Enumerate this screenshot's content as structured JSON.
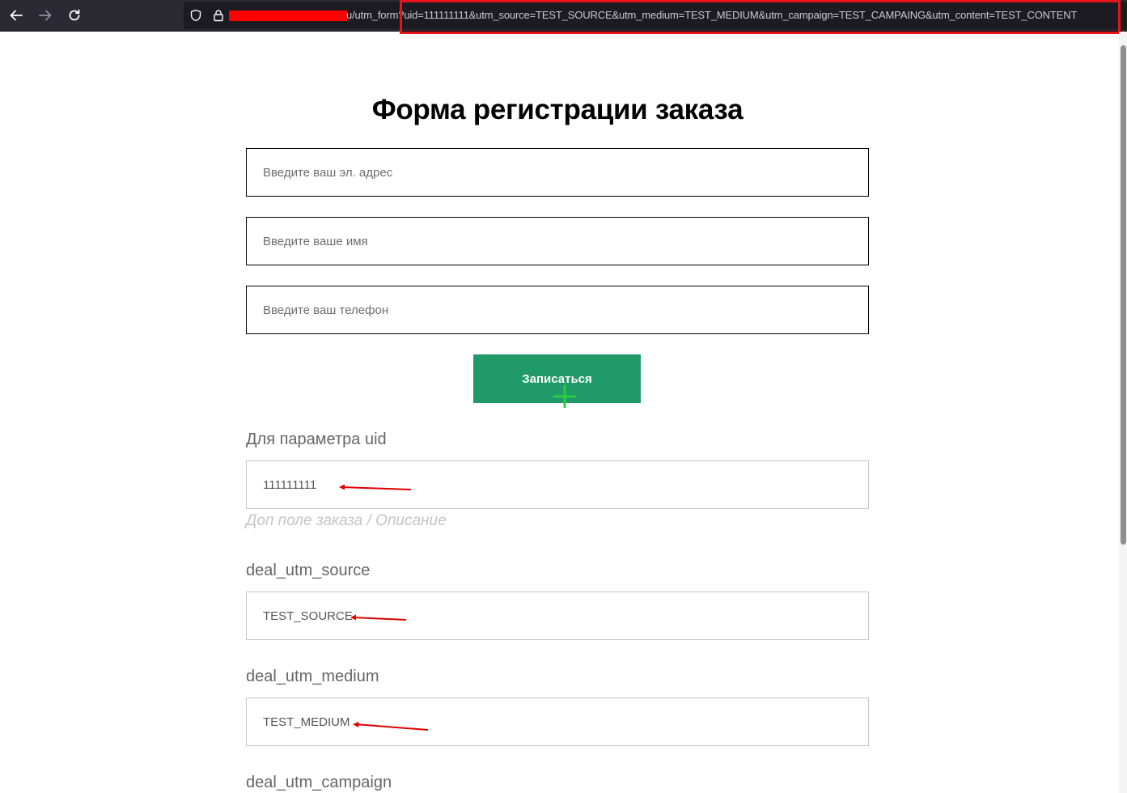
{
  "browser": {
    "url_visible": "u/utm_form?uid=111111111&utm_source=TEST_SOURCE&utm_medium=TEST_MEDIUM&utm_campaign=TEST_CAMPAING&utm_content=TEST_CONTENT",
    "highlight_color": "#e8141c",
    "redaction_color": "#ff0000"
  },
  "page": {
    "title": "Форма регистрации заказа",
    "fields": {
      "email_placeholder": "Введите ваш эл. адрес",
      "name_placeholder": "Введите ваше имя",
      "phone_placeholder": "Введите ваш телефон"
    },
    "submit_label": "Записаться",
    "uid": {
      "label": "Для параметра uid",
      "value": "111111111",
      "hint": "Доп поле заказа / Описание"
    },
    "utm_source": {
      "label": "deal_utm_source",
      "value": "TEST_SOURCE"
    },
    "utm_medium": {
      "label": "deal_utm_medium",
      "value": "TEST_MEDIUM"
    },
    "utm_campaign": {
      "label": "deal_utm_campaign"
    },
    "colors": {
      "button": "#1f9a68",
      "annotation_arrow": "#e00000",
      "cursor": "#2ecc40"
    }
  }
}
